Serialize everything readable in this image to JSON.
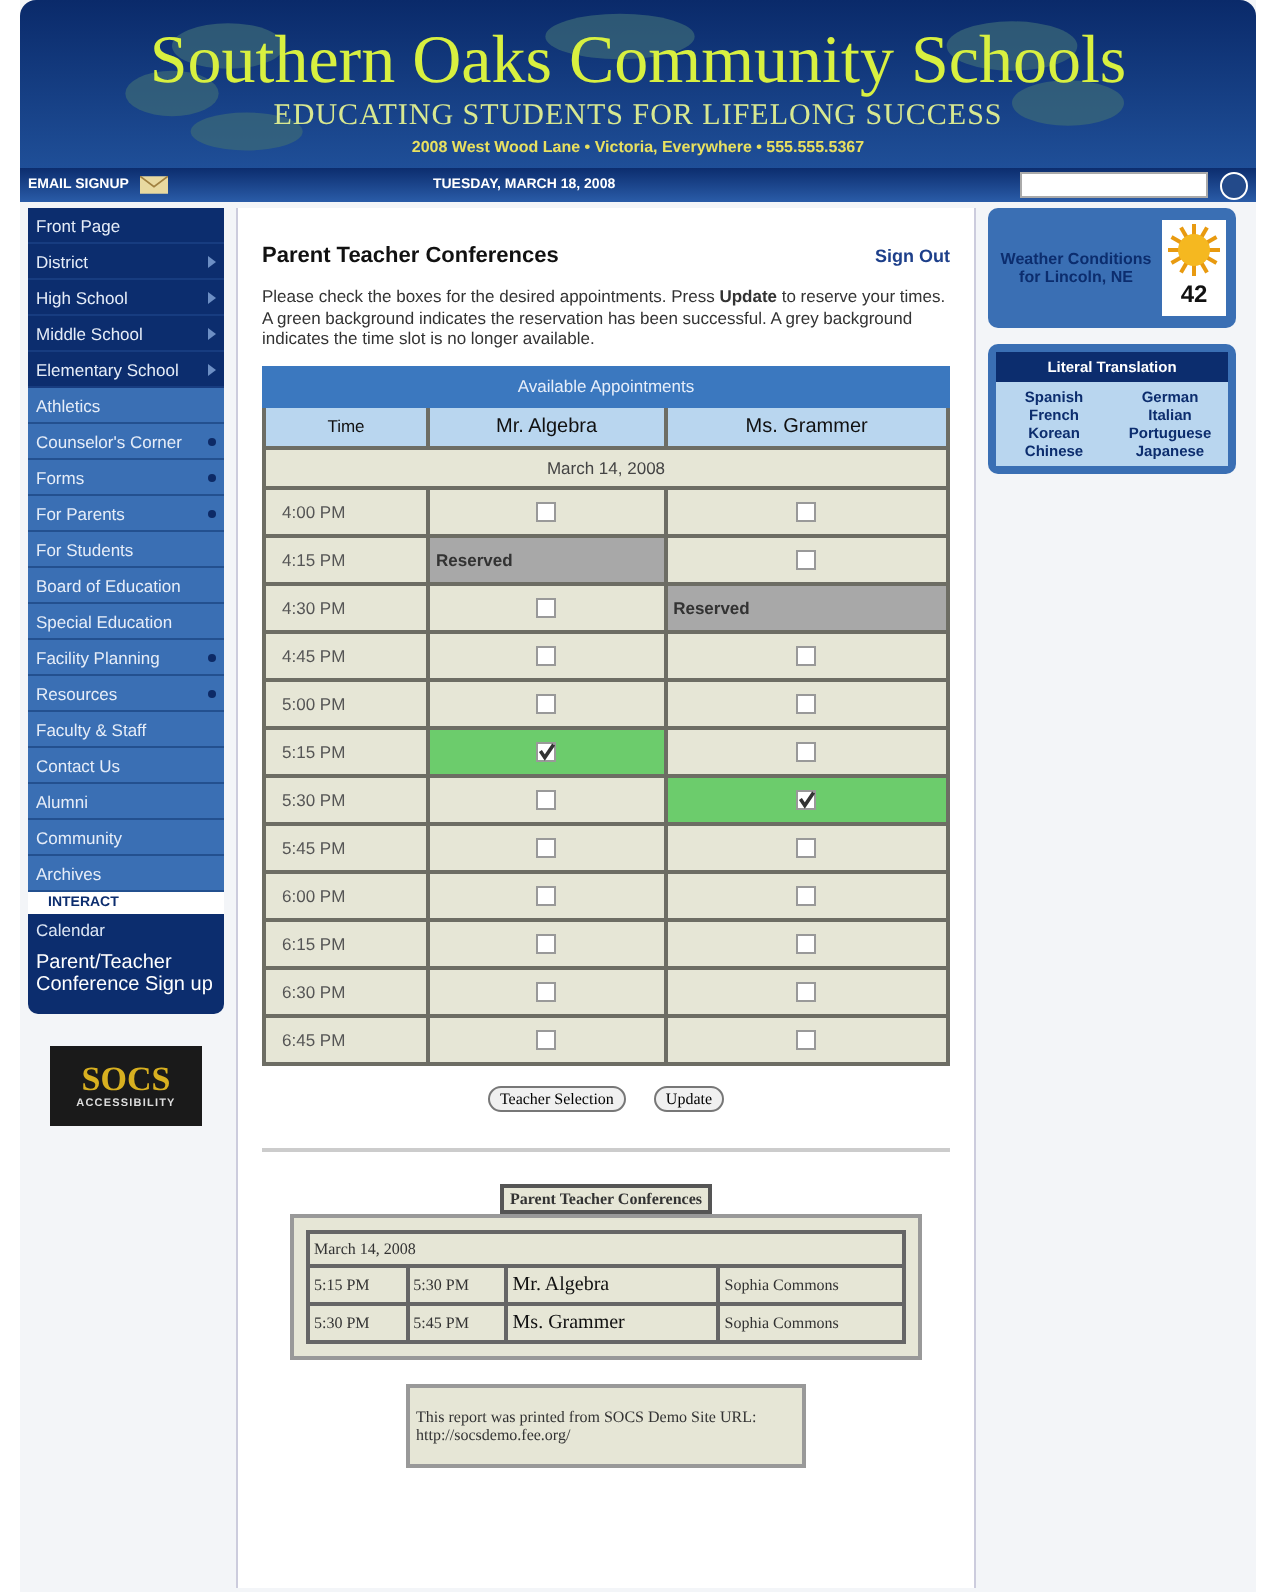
{
  "header": {
    "title": "Southern Oaks Community Schools",
    "tagline": "EDUCATING STUDENTS FOR LIFELONG SUCCESS",
    "address": "2008 West Wood Lane  •  Victoria, Everywhere  •  555.555.5367",
    "email_signup": "EMAIL SIGNUP",
    "date": "TUESDAY, MARCH 18, 2008"
  },
  "sidebar": {
    "items": [
      {
        "label": "Front Page",
        "kind": "plain"
      },
      {
        "label": "District",
        "kind": "arrow"
      },
      {
        "label": "High School",
        "kind": "arrow"
      },
      {
        "label": "Middle School",
        "kind": "arrow"
      },
      {
        "label": "Elementary School",
        "kind": "arrow"
      },
      {
        "label": "Athletics",
        "kind": "plain"
      },
      {
        "label": "Counselor's Corner",
        "kind": "dot"
      },
      {
        "label": "Forms",
        "kind": "dot"
      },
      {
        "label": "For Parents",
        "kind": "dot"
      },
      {
        "label": "For Students",
        "kind": "plain"
      },
      {
        "label": "Board of Education",
        "kind": "plain"
      },
      {
        "label": "Special Education",
        "kind": "plain"
      },
      {
        "label": "Facility Planning",
        "kind": "dot"
      },
      {
        "label": "Resources",
        "kind": "dot"
      },
      {
        "label": "Faculty & Staff",
        "kind": "plain"
      },
      {
        "label": "Contact Us",
        "kind": "plain"
      },
      {
        "label": "Alumni",
        "kind": "plain"
      },
      {
        "label": "Community",
        "kind": "plain"
      },
      {
        "label": "Archives",
        "kind": "plain"
      }
    ],
    "interact_heading": "INTERACT",
    "interact_items": [
      "Calendar",
      "Parent/Teacher Conference Sign up"
    ],
    "logo": {
      "name": "SOCS",
      "caption": "ACCESSIBILITY"
    }
  },
  "main": {
    "title": "Parent Teacher Conferences",
    "sign_out": "Sign Out",
    "instructions": "Please check the boxes for the desired appointments. Press **Update** to reserve your times. A green background indicates the reservation has been successful. A grey background indicates the time slot is no longer available.",
    "table": {
      "caption": "Available Appointments",
      "columns": [
        "Time",
        "Mr. Algebra",
        "Ms. Grammer"
      ],
      "date": "March 14, 2008",
      "rows": [
        {
          "cells": [
            {
              "kind": "time",
              "text": "4:00 PM"
            },
            {
              "kind": "checkbox",
              "checked": false
            },
            {
              "kind": "checkbox",
              "checked": false
            }
          ]
        },
        {
          "cells": [
            {
              "kind": "time",
              "text": "4:15 PM"
            },
            {
              "kind": "reserved",
              "text": "Reserved"
            },
            {
              "kind": "checkbox",
              "checked": false
            }
          ]
        },
        {
          "cells": [
            {
              "kind": "time",
              "text": "4:30 PM"
            },
            {
              "kind": "checkbox",
              "checked": false
            },
            {
              "kind": "reserved",
              "text": "Reserved"
            }
          ]
        },
        {
          "cells": [
            {
              "kind": "time",
              "text": "4:45 PM"
            },
            {
              "kind": "checkbox",
              "checked": false
            },
            {
              "kind": "checkbox",
              "checked": false
            }
          ]
        },
        {
          "cells": [
            {
              "kind": "time",
              "text": "5:00 PM"
            },
            {
              "kind": "checkbox",
              "checked": false
            },
            {
              "kind": "checkbox",
              "checked": false
            }
          ]
        },
        {
          "cells": [
            {
              "kind": "time",
              "text": "5:15 PM"
            },
            {
              "kind": "checkbox",
              "checked": true
            },
            {
              "kind": "checkbox",
              "checked": false
            }
          ]
        },
        {
          "cells": [
            {
              "kind": "time",
              "text": "5:30 PM"
            },
            {
              "kind": "checkbox",
              "checked": false
            },
            {
              "kind": "checkbox",
              "checked": true
            }
          ]
        },
        {
          "cells": [
            {
              "kind": "time",
              "text": "5:45 PM"
            },
            {
              "kind": "checkbox",
              "checked": false
            },
            {
              "kind": "checkbox",
              "checked": false
            }
          ]
        },
        {
          "cells": [
            {
              "kind": "time",
              "text": "6:00 PM"
            },
            {
              "kind": "checkbox",
              "checked": false
            },
            {
              "kind": "checkbox",
              "checked": false
            }
          ]
        },
        {
          "cells": [
            {
              "kind": "time",
              "text": "6:15 PM"
            },
            {
              "kind": "checkbox",
              "checked": false
            },
            {
              "kind": "checkbox",
              "checked": false
            }
          ]
        },
        {
          "cells": [
            {
              "kind": "time",
              "text": "6:30 PM"
            },
            {
              "kind": "checkbox",
              "checked": false
            },
            {
              "kind": "checkbox",
              "checked": false
            }
          ]
        },
        {
          "cells": [
            {
              "kind": "time",
              "text": "6:45 PM"
            },
            {
              "kind": "checkbox",
              "checked": false
            },
            {
              "kind": "checkbox",
              "checked": false
            }
          ]
        }
      ]
    },
    "buttons": [
      "Teacher Selection",
      "Update"
    ],
    "report": {
      "title": "Parent Teacher Conferences",
      "date": "March 14, 2008",
      "rows": [
        [
          "5:15 PM",
          "5:30 PM",
          "Mr. Algebra",
          "Sophia Commons"
        ],
        [
          "5:30 PM",
          "5:45 PM",
          "Ms. Grammer",
          "Sophia Commons"
        ]
      ],
      "footer": "This report was printed from SOCS Demo Site URL: http://socsdemo.fee.org/"
    }
  },
  "right": {
    "weather": {
      "text": "Weather Conditions for Lincoln, NE",
      "temperature": "42"
    },
    "translation": {
      "title": "Literal Translation",
      "languages": [
        "Spanish",
        "German",
        "French",
        "Italian",
        "Korean",
        "Portuguese",
        "Chinese",
        "Japanese"
      ]
    }
  }
}
